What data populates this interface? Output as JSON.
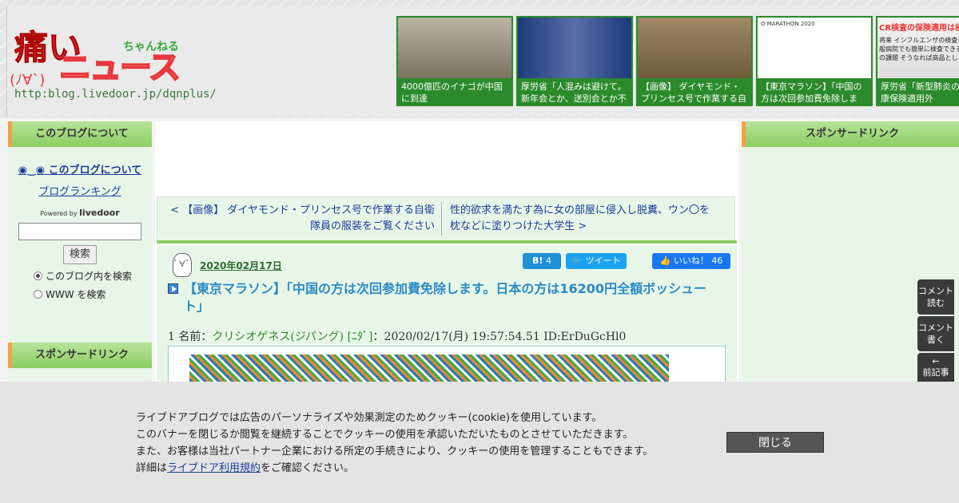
{
  "header": {
    "logo_kanji": "痛い",
    "logo_news": "ニュース",
    "logo_channel": "ちゃんねる",
    "logo_face": "(ﾉ∀`)",
    "logo_url": "http:blog.livedoor.jp/dqnplus/",
    "thumbs": [
      {
        "caption": "4000億匹のイナゴが中国に到達"
      },
      {
        "caption": "厚労省「人混みは避けて。新年会とか、送別会とか不"
      },
      {
        "caption": "【画像】 ダイヤモンド・プリンセス号で作業する自衛"
      },
      {
        "caption": "【東京マラソン】「中国の方は次回参加費免除しま",
        "mini_text": "O MARATHON 2020"
      },
      {
        "caption": "厚労省「新型肺炎の国民健康保険適用外",
        "mini_title": "CR検査の保険適用は検",
        "mini_text": "将来 インフルエンザの検査キット 一般病院でも簡単に検査できるよ 今後の課題 そうなれば商品とし"
      }
    ]
  },
  "left_sidebar": {
    "heading": "このブログについて",
    "about_link": "このブログについて",
    "ranking_link": "ブログランキング",
    "powered_by": "Powered by",
    "livedoor": "livedoor",
    "search_button": "検索",
    "radio_blog": "このブログ内を検索",
    "radio_www": "WWW を検索",
    "sponsor_heading": "スポンサードリンク"
  },
  "right_sidebar": {
    "sponsor_heading": "スポンサードリンク"
  },
  "navigation": {
    "prev": "< 【画像】 ダイヤモンド・プリンセス号で作業する自衛隊員の服装をご覧ください",
    "next": "性的欲求を満たす為に女の部屋に侵入し脱糞、ウン〇を枕などに塗りつけた大学生 >"
  },
  "article": {
    "date": "2020年02月17日",
    "hatena_label": "B!",
    "hatena_count": "4",
    "tweet_label": "ツイート",
    "fb_label": "いいね！",
    "fb_count": "46",
    "title": "【東京マラソン】「中国の方は次回参加費免除します。日本の方は16200円全額ボッシュート」",
    "res_prefix": "1 名前：",
    "res_name": "クリシオゲネス(ジパング) [ﾆﾀﾞ]",
    "res_suffix": "：2020/02/17(月) 19:57:54.51 ID:ErDuGcHl0"
  },
  "float_buttons": {
    "comment_read_1": "コメント",
    "comment_read_2": "読む",
    "comment_write_1": "コメント",
    "comment_write_2": "書く",
    "prev_article_arrow": "←",
    "prev_article": "前記事"
  },
  "cookie": {
    "line1": "ライブドアブログでは広告のパーソナライズや効果測定のためクッキー(cookie)を使用しています。",
    "line2": "このバナーを閉じるか閲覧を継続することでクッキーの使用を承認いただいたものとさせていただきます。",
    "line3": "また、お客様は当社パートナー企業における所定の手続きにより、クッキーの使用を管理することもできます。",
    "line4_prefix": "詳細は",
    "line4_link": "ライブドア利用規約",
    "line4_suffix": "をご確認ください。",
    "close": "閉じる"
  }
}
